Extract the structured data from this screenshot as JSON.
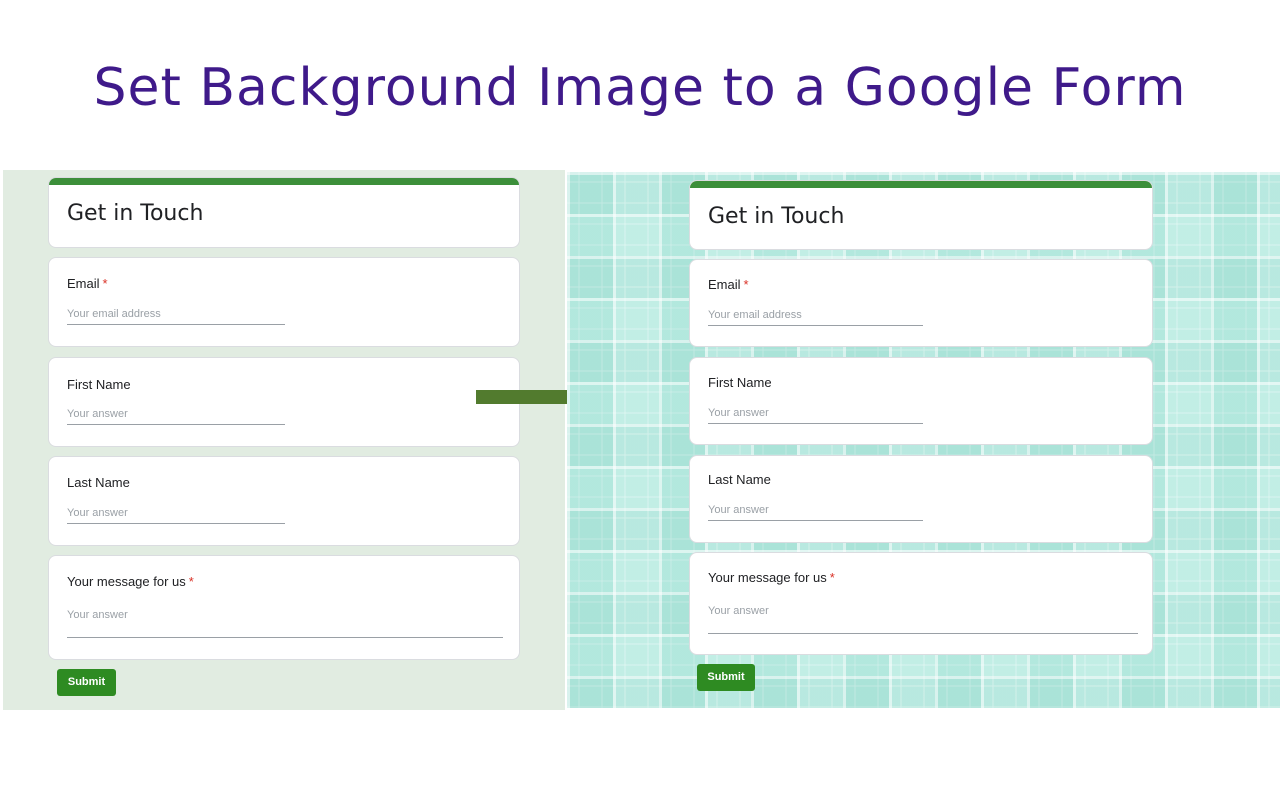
{
  "page": {
    "title": "Set Background Image to a Google Form"
  },
  "form": {
    "title": "Get in Touch",
    "questions": [
      {
        "label": "Email",
        "required": true,
        "placeholder": "Your email address"
      },
      {
        "label": "First Name",
        "required": false,
        "placeholder": "Your answer"
      },
      {
        "label": "Last Name",
        "required": false,
        "placeholder": "Your answer"
      },
      {
        "label": "Your message for us",
        "required": true,
        "placeholder": "Your answer"
      }
    ],
    "required_mark": "*",
    "submit_label": "Submit"
  },
  "colors": {
    "title": "#3f1a8a",
    "accent_bar": "#3c8f3a",
    "submit": "#2e8b22",
    "left_background": "#e1ece1",
    "right_background": "#d3f3ec",
    "arrow": "#527b2e",
    "required": "#d93025"
  },
  "icons": {
    "arrow": "right-arrow-icon"
  }
}
